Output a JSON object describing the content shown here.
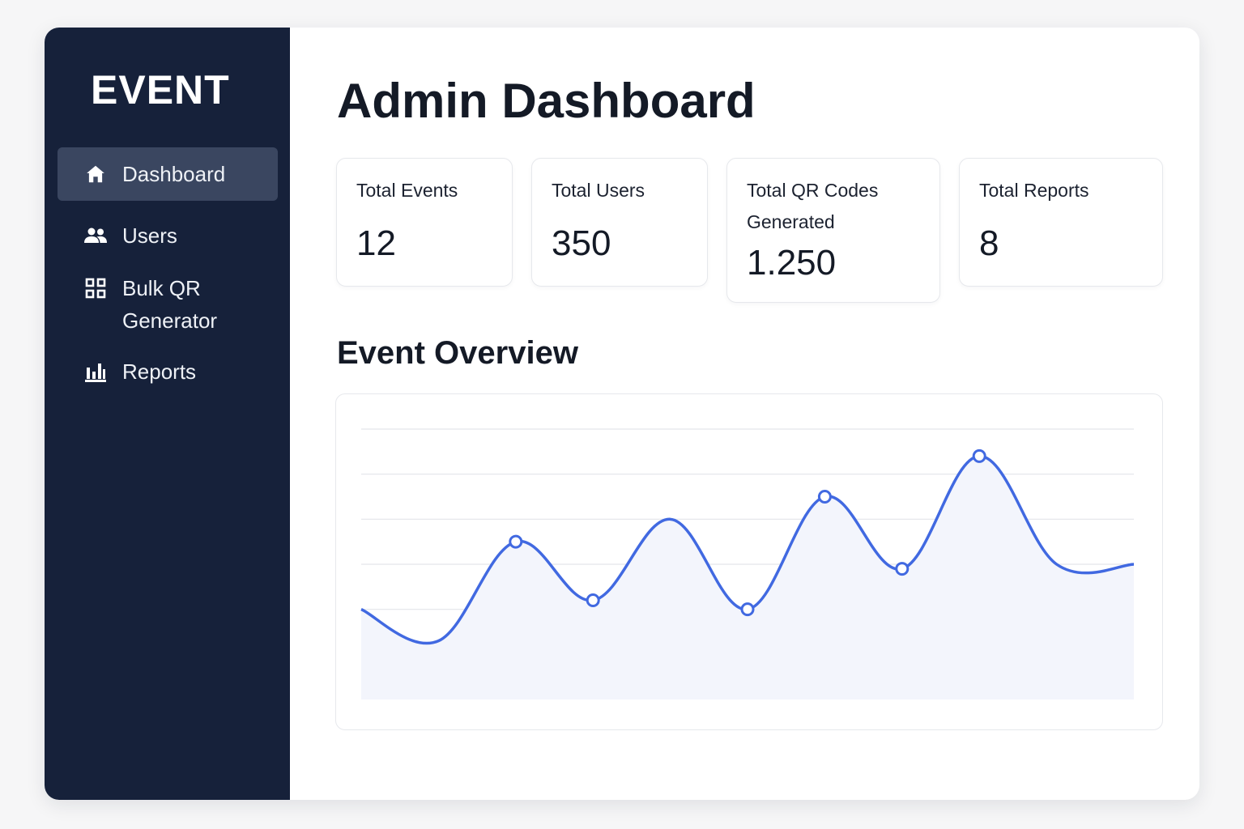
{
  "sidebar": {
    "brand": "EVENT",
    "items": [
      {
        "label": "Dashboard",
        "icon": "home-icon",
        "active": true
      },
      {
        "label": "Users",
        "icon": "users-icon",
        "active": false
      },
      {
        "label_line1": "Bulk QR",
        "label_line2": "Generator",
        "icon": "qr-grid-icon",
        "active": false
      },
      {
        "label": "Reports",
        "icon": "bar-chart-icon",
        "active": false
      }
    ]
  },
  "main": {
    "title": "Admin Dashboard",
    "stats": [
      {
        "label": "Total Events",
        "value": "12"
      },
      {
        "label": "Total Users",
        "value": "350"
      },
      {
        "label": "Total QR  Codes Generated",
        "value": "1.250"
      },
      {
        "label": "Total Reports",
        "value": "8"
      }
    ],
    "section_title": "Event Overview"
  },
  "colors": {
    "sidebar_bg": "#16213a",
    "active_item_bg": "#3a4660",
    "line": "#4169e1",
    "area_fill": "#f3f5fc",
    "grid": "#e3e5ea"
  },
  "chart_data": {
    "type": "area",
    "title": "",
    "xlabel": "",
    "ylabel": "",
    "ylim": [
      0,
      6
    ],
    "grid": true,
    "x": [
      0,
      1,
      2,
      3,
      4,
      5,
      6,
      7,
      8,
      9,
      10
    ],
    "series": [
      {
        "values": [
          2.0,
          1.3,
          3.5,
          2.2,
          4.0,
          2.0,
          4.5,
          2.9,
          5.4,
          3.0,
          3.0
        ],
        "markers": [
          false,
          false,
          true,
          true,
          false,
          true,
          true,
          true,
          true,
          false,
          false
        ]
      }
    ]
  }
}
